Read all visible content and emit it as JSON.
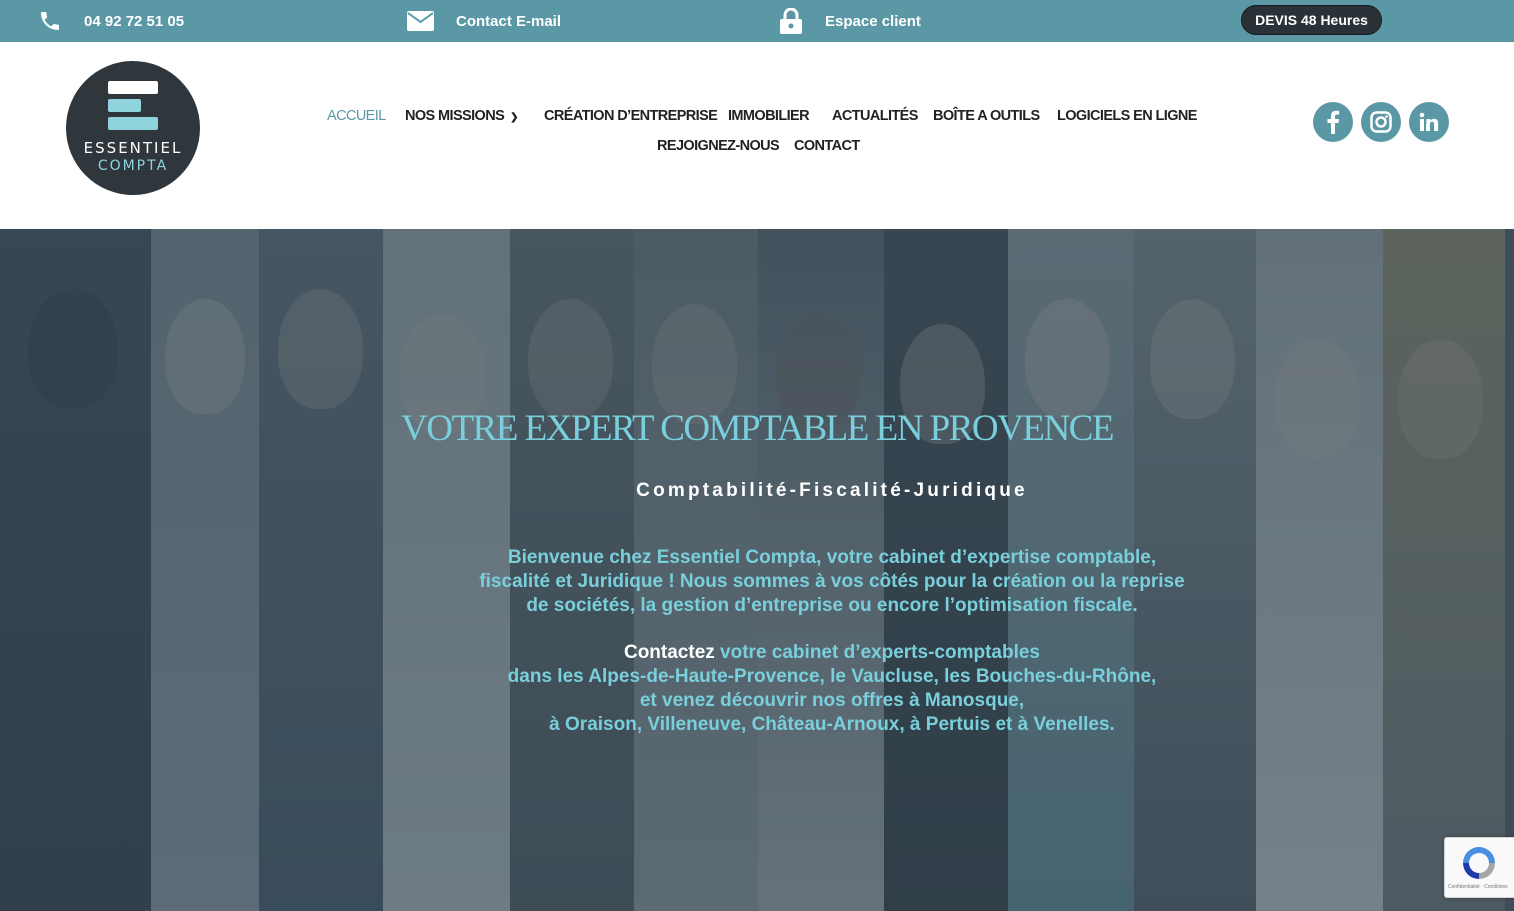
{
  "topbar": {
    "phone": "04 92 72 51 05",
    "email_label": "Contact E-mail",
    "client_label": "Espace client",
    "devis_label": "DEVIS 48 Heures"
  },
  "logo": {
    "line1": "ESSENTIEL",
    "line2": "COMPTA"
  },
  "nav": {
    "items": [
      {
        "label": "ACCUEIL"
      },
      {
        "label": "NOS MISSIONS"
      },
      {
        "label": "CRÉATION D’ENTREPRISE"
      },
      {
        "label": "IMMOBILIER"
      },
      {
        "label": "ACTUALITÉS"
      },
      {
        "label": "BOÎTE A OUTILS"
      },
      {
        "label": "LOGICIELS EN LIGNE"
      },
      {
        "label": "REJOIGNEZ-NOUS"
      },
      {
        "label": "CONTACT"
      }
    ]
  },
  "social": [
    "facebook-icon",
    "instagram-icon",
    "linkedin-icon"
  ],
  "hero": {
    "title": "VOTRE EXPERT COMPTABLE EN PROVENCE",
    "subtitle": "Comptabilité-Fiscalité-Juridique",
    "intro_lines": [
      "Bienvenue chez Essentiel Compta, votre cabinet d’expertise comptable,",
      "fiscalité et Juridique ! Nous sommes à vos côtés pour la création ou la reprise",
      "de sociétés, la gestion d’entreprise ou encore l’optimisation fiscale."
    ],
    "contact_strong": "Contactez",
    "contact_line1_rest": " votre cabinet d’experts-comptables",
    "contact_lines": [
      "dans les Alpes-de-Haute-Provence, le Vaucluse, les Bouches-du-Rhône,",
      "et venez découvrir nos offres à Manosque,",
      "à Oraison, Villeneuve, Château-Arnoux, à Pertuis et à Venelles."
    ]
  },
  "recaptcha": {
    "text": "Confidentialité - Conditions"
  },
  "colors": {
    "brand": "#5b98a6",
    "accent_text": "#79cfdb",
    "dark": "#2a3137"
  }
}
